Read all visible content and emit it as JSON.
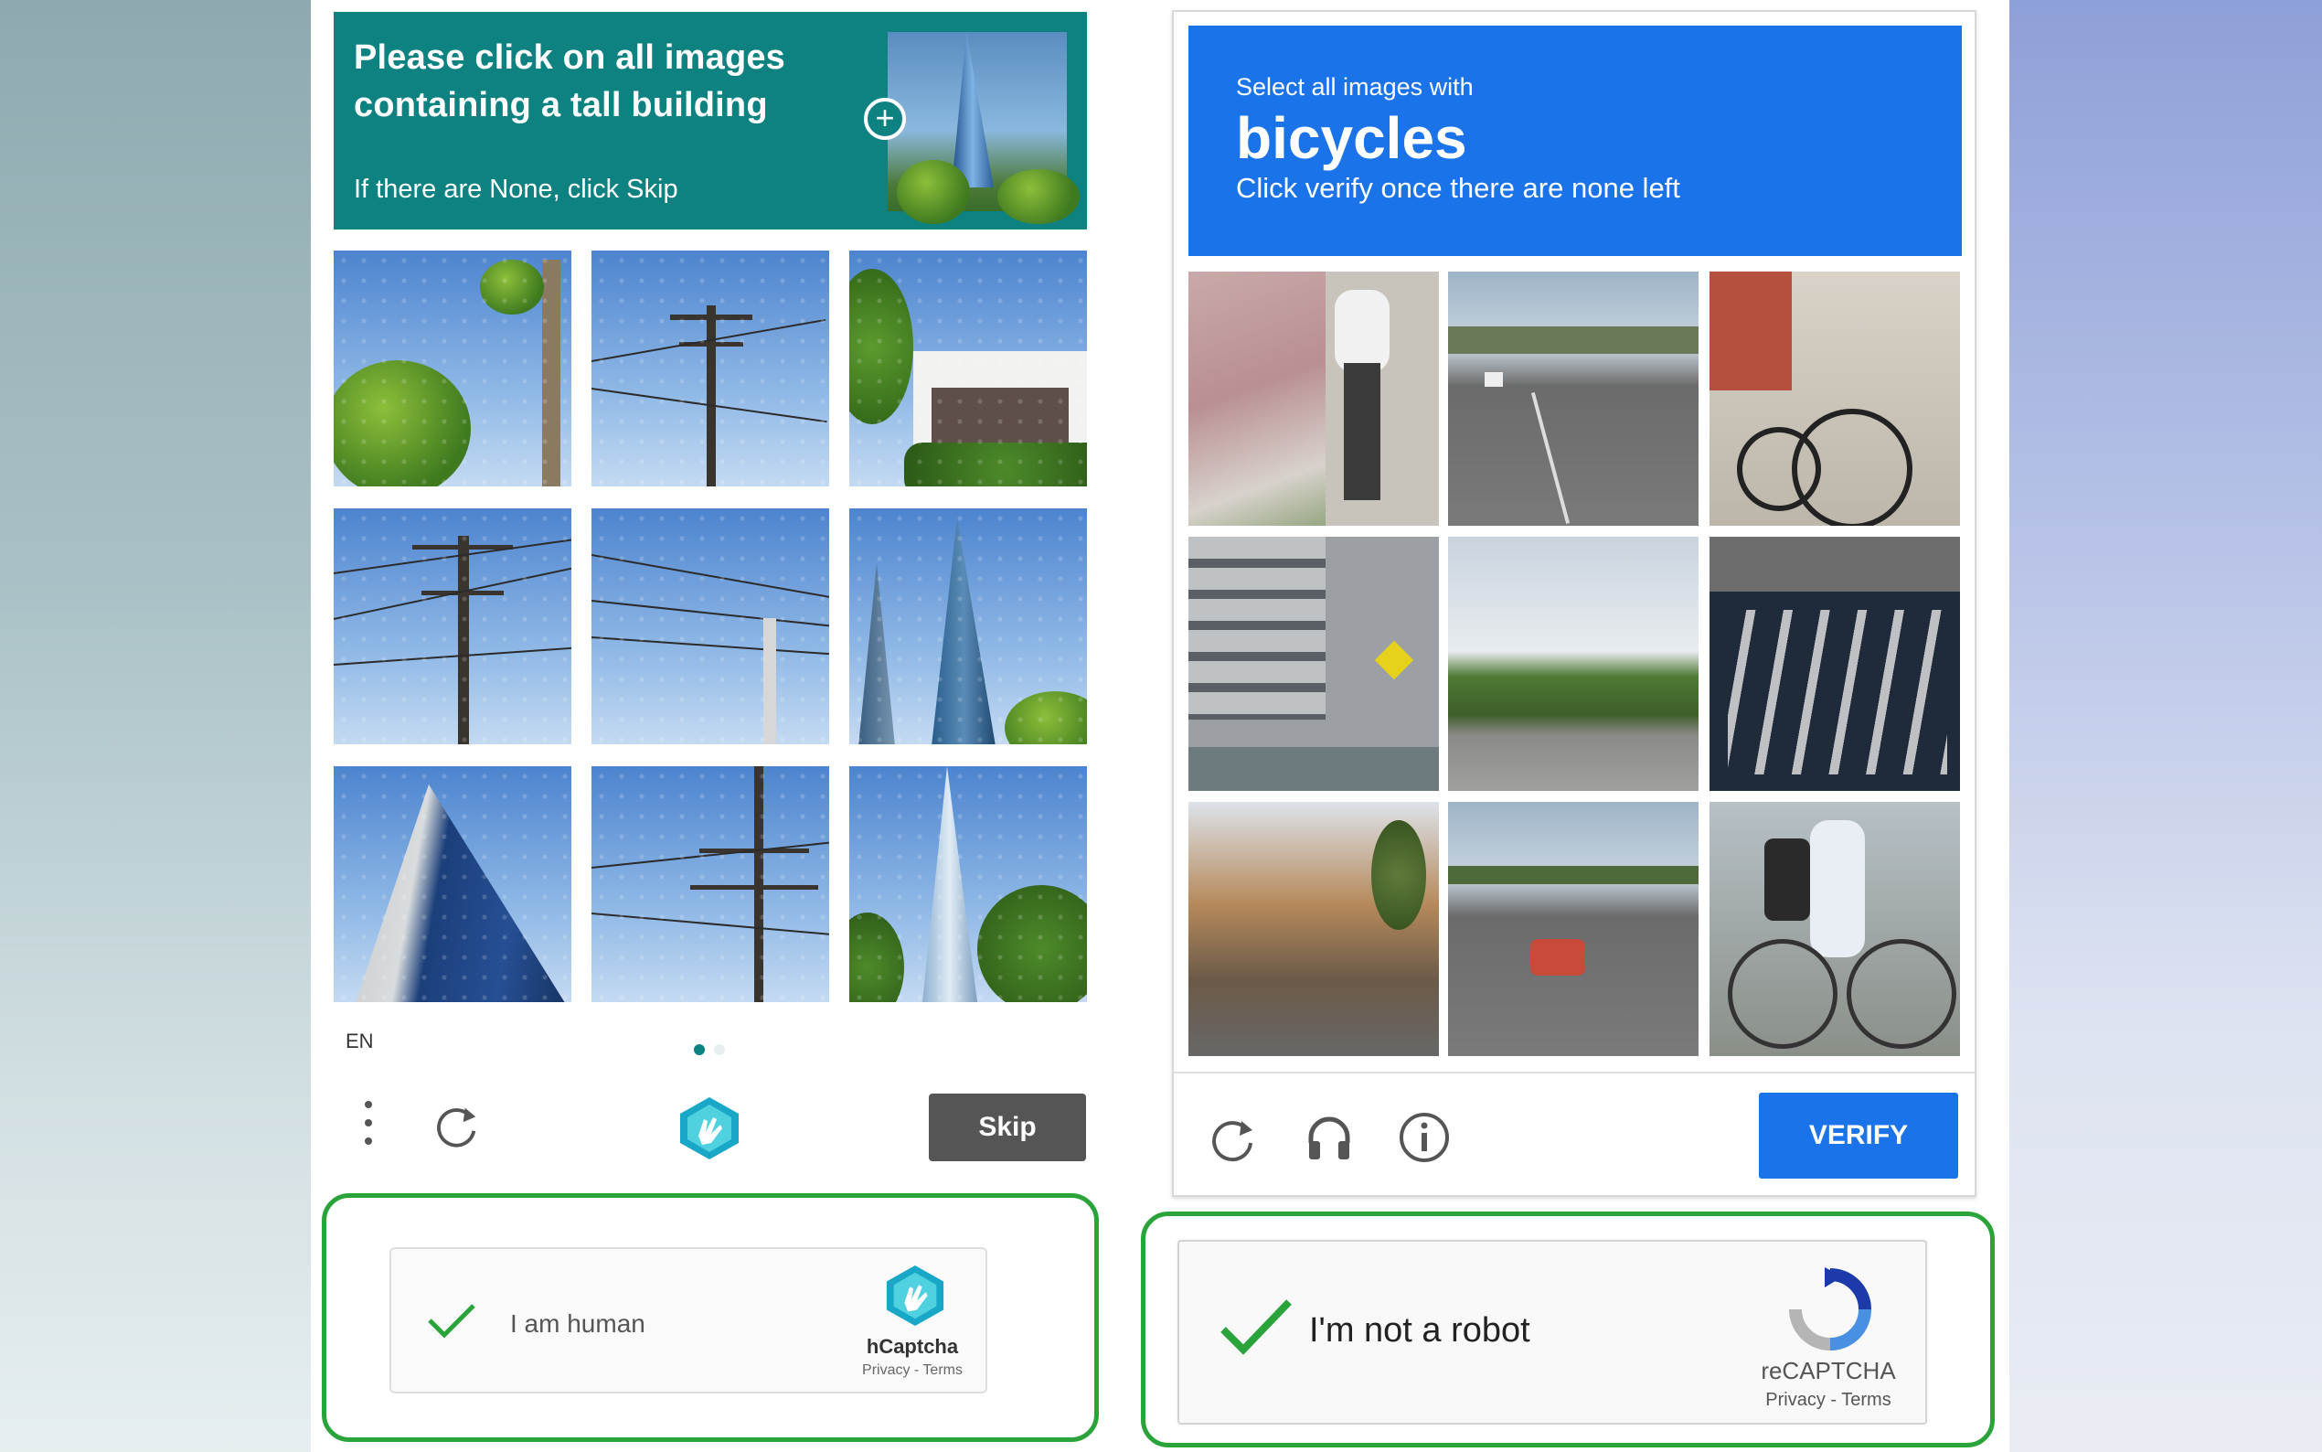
{
  "hcaptcha": {
    "prompt_line1": "Please click on all images",
    "prompt_line2": "containing a tall building",
    "prompt_sub": "If there are None, click Skip",
    "tiles": [
      {
        "label": "tree-tile"
      },
      {
        "label": "power-pole-tile"
      },
      {
        "label": "house-tile"
      },
      {
        "label": "power-lines-tile"
      },
      {
        "label": "power-lines-tile"
      },
      {
        "label": "tall-building-tile"
      },
      {
        "label": "tall-building-tile"
      },
      {
        "label": "power-pole-tile"
      },
      {
        "label": "tall-building-tile"
      }
    ],
    "language": "EN",
    "page_indicator": {
      "current": 1,
      "total": 2
    },
    "skip_label": "Skip",
    "accent_color": "#0e8181",
    "widget": {
      "label": "I am human",
      "brand": "hCaptcha",
      "links": "Privacy - Terms"
    }
  },
  "recaptcha": {
    "prompt_pre": "Select all images with",
    "prompt_object": "bicycles",
    "prompt_post": "Click verify once there are none left",
    "tiles": [
      {
        "label": "cyclist-tile"
      },
      {
        "label": "highway-tile"
      },
      {
        "label": "bicycle-tile"
      },
      {
        "label": "street-crossing-tile"
      },
      {
        "label": "highway-tile"
      },
      {
        "label": "road-markings-tile"
      },
      {
        "label": "street-tile"
      },
      {
        "label": "road-car-tile"
      },
      {
        "label": "cyclist-tile"
      }
    ],
    "verify_label": "VERIFY",
    "accent_color": "#1a73e8",
    "widget": {
      "label": "I'm not a robot",
      "brand": "reCAPTCHA",
      "links": "Privacy - Terms"
    }
  },
  "highlight_color": "#2aa43a"
}
